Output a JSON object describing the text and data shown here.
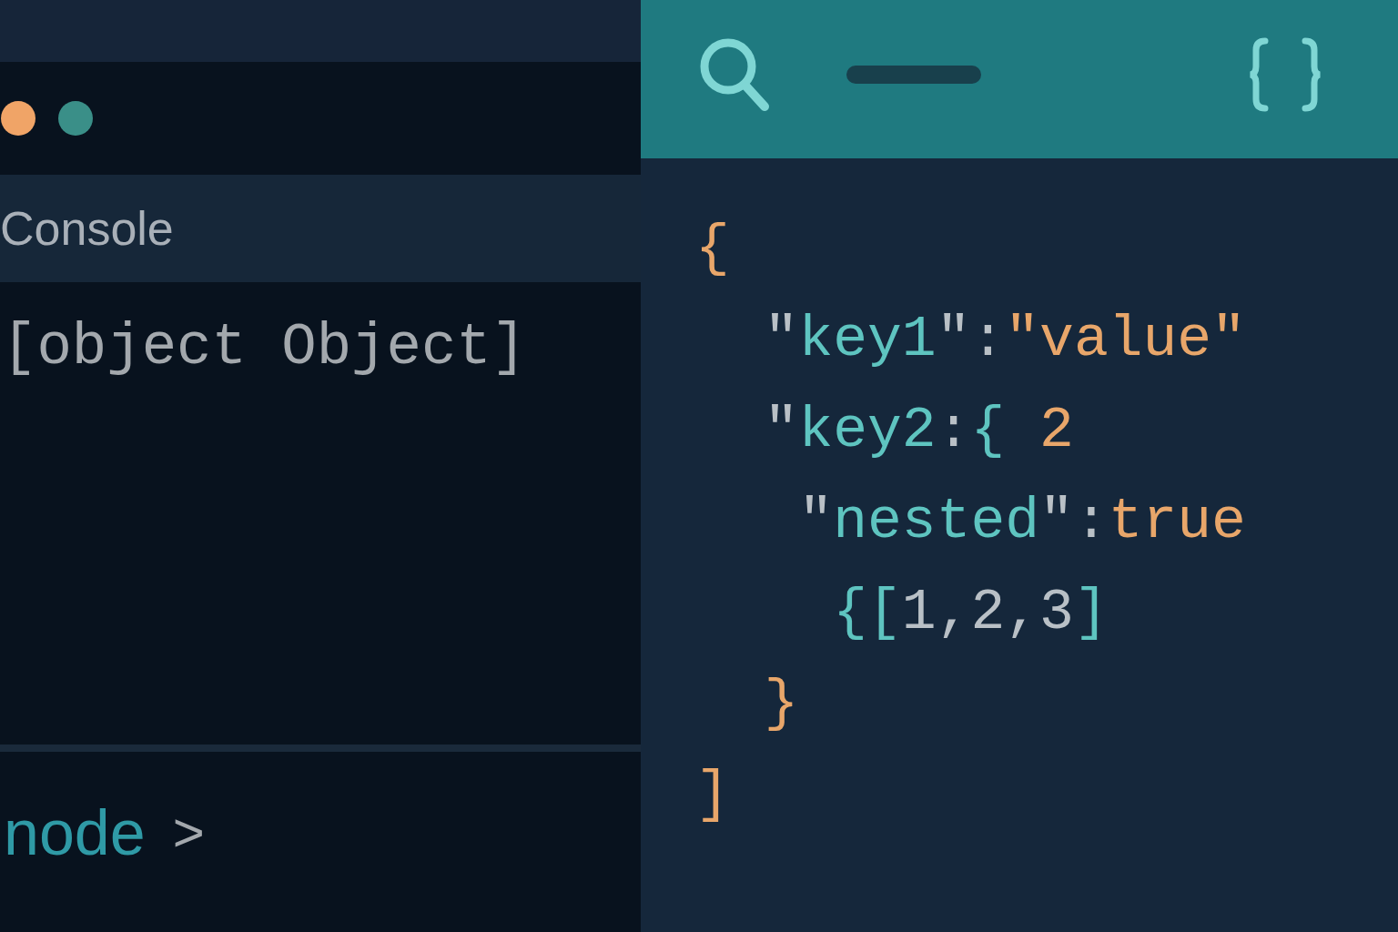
{
  "console": {
    "title": "Console",
    "output": "[object Object]",
    "prompt": {
      "command": "node",
      "symbol": ">"
    }
  },
  "window_dots": [
    {
      "color": "#f0a467"
    },
    {
      "color": "#3a8f88"
    }
  ],
  "json_viewer": {
    "lines": [
      [
        {
          "text": "{",
          "kind": "value"
        }
      ],
      [
        {
          "text": "  \"",
          "kind": "punct"
        },
        {
          "text": "key1",
          "kind": "key"
        },
        {
          "text": "\"",
          "kind": "punct"
        },
        {
          "text": ":",
          "kind": "punct"
        },
        {
          "text": "\"value\"",
          "kind": "value"
        }
      ],
      [
        {
          "text": "  \"",
          "kind": "punct"
        },
        {
          "text": "key2",
          "kind": "key"
        },
        {
          "text": ":",
          "kind": "punct"
        },
        {
          "text": "{",
          "kind": "key"
        },
        {
          "text": " 2",
          "kind": "value"
        }
      ],
      [
        {
          "text": "   \"",
          "kind": "punct"
        },
        {
          "text": "nested",
          "kind": "key"
        },
        {
          "text": "\"",
          "kind": "punct"
        },
        {
          "text": ":",
          "kind": "punct"
        },
        {
          "text": "true",
          "kind": "value"
        }
      ],
      [
        {
          "text": "    {[",
          "kind": "key"
        },
        {
          "text": "1,2,3",
          "kind": "punct"
        },
        {
          "text": "]",
          "kind": "key"
        }
      ],
      [
        {
          "text": "  }",
          "kind": "value"
        }
      ],
      [
        {
          "text": "]",
          "kind": "value"
        }
      ]
    ]
  }
}
